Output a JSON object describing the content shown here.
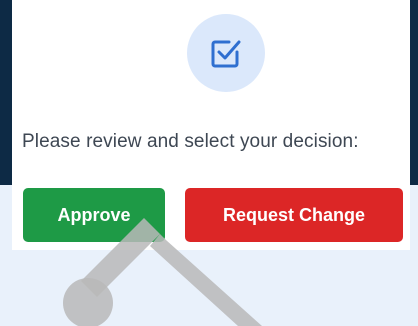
{
  "dialog": {
    "prompt": "Please review and select your decision:",
    "icon": "check-square-icon",
    "buttons": {
      "approve_label": "Approve",
      "request_change_label": "Request Change"
    }
  },
  "colors": {
    "approve": "#1e9a46",
    "request_change": "#dc2626",
    "icon_bg": "#dbe8fb",
    "icon_stroke": "#2f6fd0"
  }
}
